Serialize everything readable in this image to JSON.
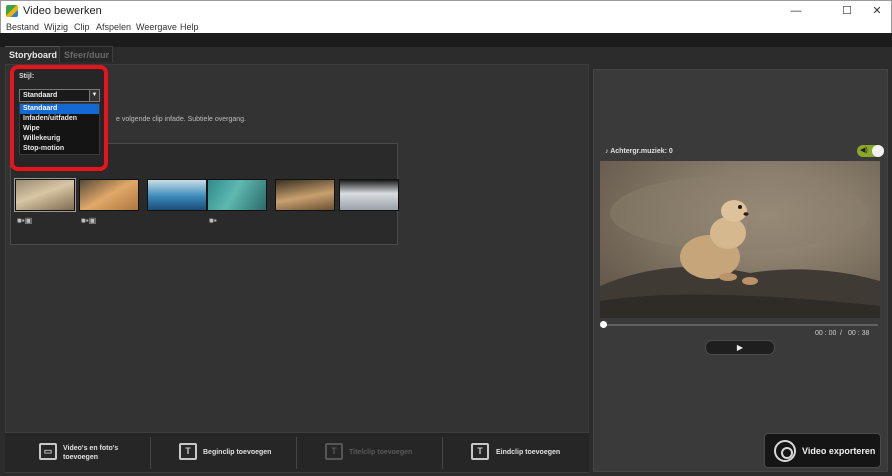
{
  "window": {
    "title": "Video bewerken",
    "controls": {
      "minimize": "—",
      "maximize": "☐",
      "close": "✕"
    }
  },
  "menu": [
    "Bestand",
    "Wijzig",
    "Clip",
    "Afspelen",
    "Weergave",
    "Help"
  ],
  "tabs": [
    {
      "label": "Storyboard",
      "active": true
    },
    {
      "label": "Sfeer/duur",
      "active": false
    }
  ],
  "style_panel": {
    "label": "Stijl:",
    "selected": "Standaard",
    "options": [
      "Standaard",
      "Infaden/uitfaden",
      "Wipe",
      "Willekeurig",
      "Stop-motion"
    ],
    "highlight_color": "#e8141c",
    "selection_color": "#1469d2"
  },
  "effect_description": "e volgende clip infade. Subtiele overgang.",
  "storyboard": {
    "clips": [
      {
        "icon": "video-photo-icon",
        "selected": true
      },
      {
        "icon": "video-photo-icon",
        "selected": false
      },
      {
        "icon": "",
        "selected": false
      },
      {
        "icon": "video-icon",
        "selected": false
      },
      {
        "icon": "",
        "selected": false
      },
      {
        "icon": "",
        "selected": false
      }
    ]
  },
  "bottom_actions": {
    "add_media": "Video's en foto's toevoegen",
    "add_start": "Beginclip toevoegen",
    "add_title": "Titelclip toevoegen",
    "add_end": "Eindclip toevoegen"
  },
  "preview": {
    "music_label": "Achtergr.muziek: 0",
    "music_enabled": true,
    "toggle_color": "#8aa62c",
    "current_time": "00 : 00",
    "separator": "/",
    "total_time": "00 : 38",
    "play_symbol": "▶"
  },
  "export_label": "Video exporteren"
}
